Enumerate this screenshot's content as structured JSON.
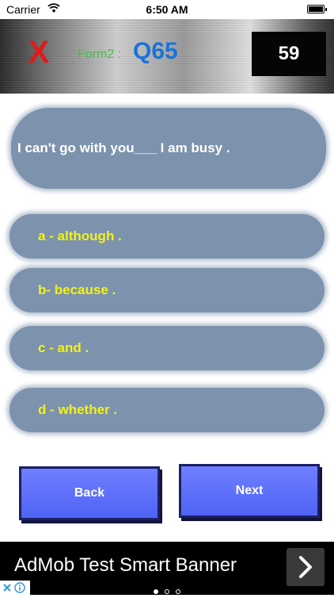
{
  "status_bar": {
    "carrier": "Carrier",
    "time": "6:50 AM"
  },
  "header": {
    "close_symbol": "X",
    "form_label": "Form2 :",
    "question_number": "Q65",
    "timer": "59",
    "colors": {
      "close": "#e01a1a",
      "form_label": "#3cc43c",
      "question_number": "#1a73d9"
    }
  },
  "question": {
    "text": "I can't go with you___ I am busy ."
  },
  "answers": [
    {
      "label": "a - although ."
    },
    {
      "label": "b- because ."
    },
    {
      "label": "c - and ."
    },
    {
      "label": "d - whether ."
    }
  ],
  "navigation": {
    "back_label": "Back",
    "next_label": "Next"
  },
  "ad_banner": {
    "text": "AdMob Test Smart Banner",
    "icons": [
      "adchoices-close-icon",
      "adchoices-info-icon",
      "chevron-right-icon"
    ],
    "page_dots": 3,
    "active_dot": 0
  },
  "theme": {
    "card": "#7d92ad",
    "answer_text": "#f2f21a",
    "button": "#5a6cf8"
  }
}
